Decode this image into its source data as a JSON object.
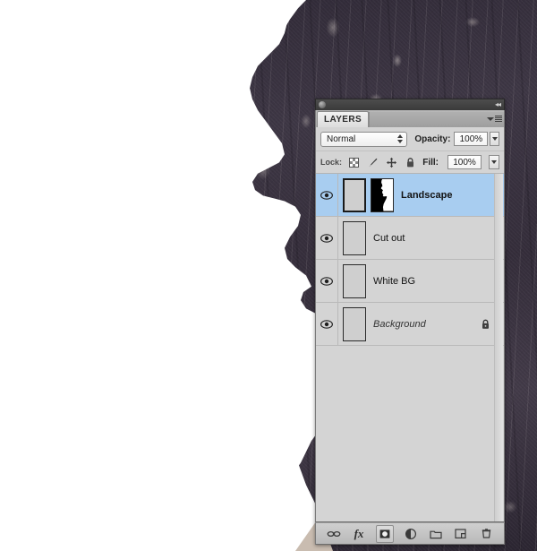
{
  "app": {
    "panel_title": "LAYERS",
    "titlebar": {
      "grip": "panel-grip",
      "collapse": "◂◂"
    }
  },
  "blend": {
    "mode_label": "Normal",
    "opacity_label": "Opacity:",
    "opacity_value": "100%",
    "fill_label": "Fill:",
    "fill_value": "100%"
  },
  "lock": {
    "label": "Lock:",
    "items": [
      {
        "name": "lock-transparent-pixels",
        "icon": "checkerboard-icon"
      },
      {
        "name": "lock-image-pixels",
        "icon": "brush-icon"
      },
      {
        "name": "lock-position",
        "icon": "move-icon"
      },
      {
        "name": "lock-all",
        "icon": "padlock-icon"
      }
    ]
  },
  "layers": [
    {
      "name": "Landscape",
      "visible": true,
      "selected": true,
      "style": "bold",
      "thumb": "forest-photo",
      "has_mask": true,
      "mask": "silhouette-mask",
      "locked": false
    },
    {
      "name": "Cut out",
      "visible": true,
      "selected": false,
      "style": "normal",
      "thumb": "cutout-portrait",
      "has_mask": false,
      "locked": false
    },
    {
      "name": "White BG",
      "visible": true,
      "selected": false,
      "style": "normal",
      "thumb": "white-fill",
      "has_mask": false,
      "locked": false
    },
    {
      "name": "Background",
      "visible": true,
      "selected": false,
      "style": "italic",
      "thumb": "background-portrait",
      "has_mask": false,
      "locked": true
    }
  ],
  "footer": [
    {
      "name": "link-layers-button",
      "icon": "link-icon",
      "label": "⚭"
    },
    {
      "name": "layer-style-button",
      "icon": "fx-icon",
      "label": "fx"
    },
    {
      "name": "add-layer-mask-button",
      "icon": "mask-icon",
      "label": "◎"
    },
    {
      "name": "adjustment-layer-button",
      "icon": "half-circle-icon",
      "label": "◑"
    },
    {
      "name": "new-group-button",
      "icon": "folder-icon",
      "label": "▭"
    },
    {
      "name": "new-layer-button",
      "icon": "new-layer-icon",
      "label": "⧉"
    },
    {
      "name": "delete-layer-button",
      "icon": "trash-icon",
      "label": "☒"
    }
  ],
  "colors": {
    "panel_bg": "#d4d4d4",
    "selection": "#a8cdf0",
    "forest_dark": "#3b3440",
    "ground_tan": "#c9bcb0",
    "canvas_white": "#ffffff"
  },
  "canvas": {
    "artwork": "double-exposure-portrait-silhouette-with-forest"
  }
}
